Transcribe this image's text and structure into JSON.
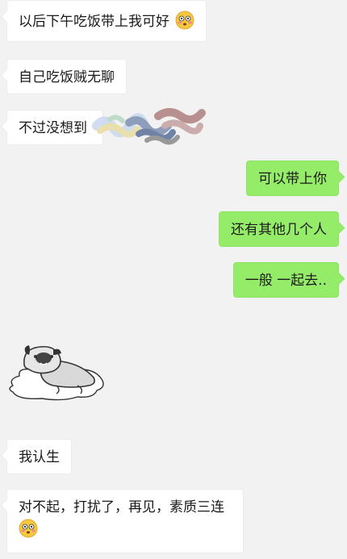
{
  "chat": {
    "messages": [
      {
        "side": "in",
        "text": "以后下午吃饭带上我可好",
        "emoji": "flushed-face-emoji"
      },
      {
        "side": "in",
        "text": "自己吃饭贼无聊"
      },
      {
        "side": "in",
        "text": "不过没想到"
      },
      {
        "side": "out",
        "text": "可以带上你"
      },
      {
        "side": "out",
        "text": "还有其他几个人"
      },
      {
        "side": "out",
        "text": "一般 一起去.."
      },
      {
        "side": "in",
        "sticker": "lying-pug-sticker"
      },
      {
        "side": "in",
        "text": "我认生"
      },
      {
        "side": "in",
        "text": "对不起，打扰了，再见，素质三连",
        "emoji": "flushed-face-emoji"
      }
    ]
  },
  "colors": {
    "background": "#f2f2f2",
    "incoming_bubble": "#ffffff",
    "outgoing_bubble": "#95ec69"
  }
}
